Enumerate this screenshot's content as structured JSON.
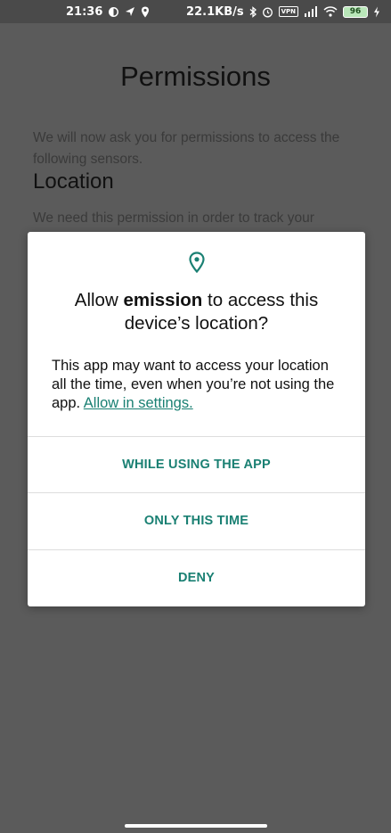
{
  "status_bar": {
    "time": "21:36",
    "network_speed": "22.1KB/s",
    "vpn_label": "VPN",
    "battery_level": "96",
    "icons": [
      "circle-icon",
      "send-icon",
      "location-icon",
      "bluetooth-icon",
      "alarm-icon",
      "vpn-icon",
      "signal-icon",
      "wifi-icon",
      "battery-icon",
      "charging-icon"
    ]
  },
  "background": {
    "title": "Permissions",
    "intro": "We will now ask you for permissions to access the following sensors.",
    "section_title": "Location",
    "section_text": "We need this permission in order to track your"
  },
  "dialog": {
    "icon": "location-pin-icon",
    "accent_color": "#1a8073",
    "title_prefix": "Allow ",
    "app_name": "emission",
    "title_suffix": " to access this device’s location?",
    "body": "This app may want to access your location all the time, even when you’re not using the app. ",
    "body_link": "Allow in settings.",
    "buttons": {
      "while_using": "WHILE USING THE APP",
      "only_this_time": "ONLY THIS TIME",
      "deny": "DENY"
    }
  }
}
